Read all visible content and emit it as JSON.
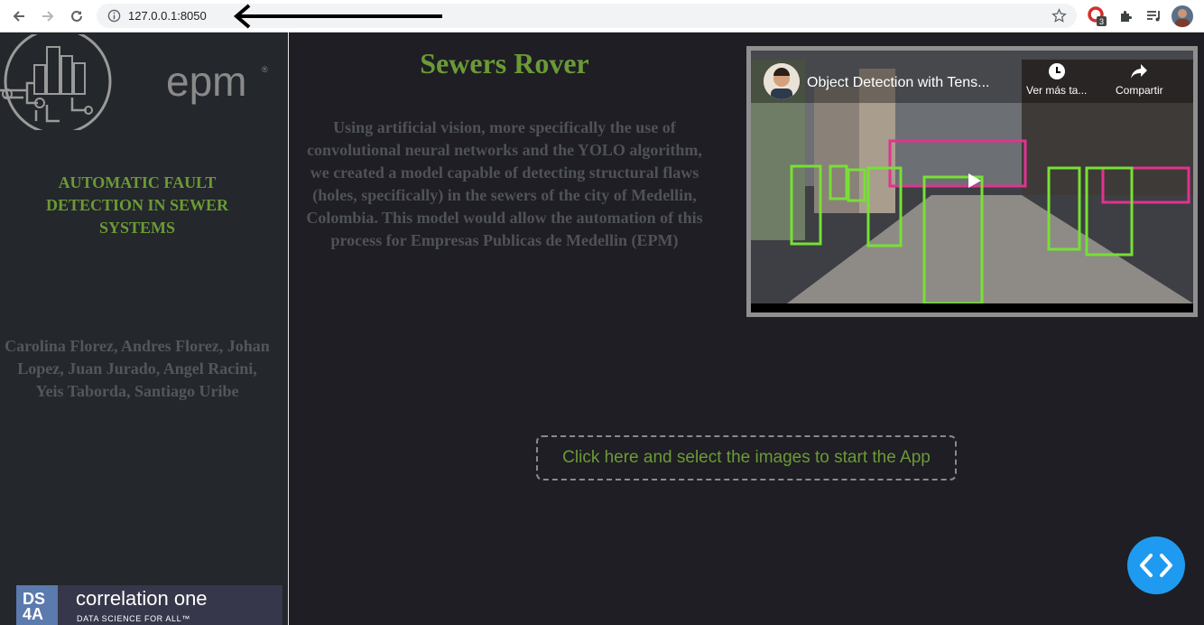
{
  "browser": {
    "url": "127.0.0.1:8050",
    "extension_badge": "3"
  },
  "sidebar": {
    "project_title": "AUTOMATIC FAULT DETECTION IN SEWER SYSTEMS",
    "authors": "Carolina Florez, Andres Florez, Johan Lopez, Juan Jurado, Angel Racini, Yeis Taborda, Santiago Uribe",
    "epm_logo_text": "epm",
    "banner": {
      "ds_line1": "DS",
      "ds_line2": "4A",
      "brand": "correlation one",
      "tagline": "DATA SCIENCE FOR ALL™"
    }
  },
  "main": {
    "title": "Sewers Rover",
    "description": "Using artificial vision, more specifically the use of convolutional neural networks and the YOLO algorithm, we created a model capable of detecting structural flaws (holes, specifically) in the sewers of the city of Medellin, Colombia. This model would allow the automation of this process for Empresas Publicas de Medellin (EPM)",
    "upload_label": "Click here and select the images to start the App"
  },
  "video": {
    "title": "Object Detection with Tens...",
    "watch_later": "Ver más ta...",
    "share": "Compartir"
  },
  "colors": {
    "accent_green": "#6b9a36",
    "fab_blue": "#1e9bf0",
    "background": "#1e1e24",
    "sidebar": "#24272b"
  },
  "icons": {
    "back": "arrow-left-icon",
    "forward": "arrow-right-icon",
    "reload": "reload-icon",
    "info": "info-icon",
    "star": "star-icon",
    "extensions": "puzzle-icon",
    "media": "playlist-icon",
    "play": "play-icon",
    "dev_tools": "code-icon"
  }
}
